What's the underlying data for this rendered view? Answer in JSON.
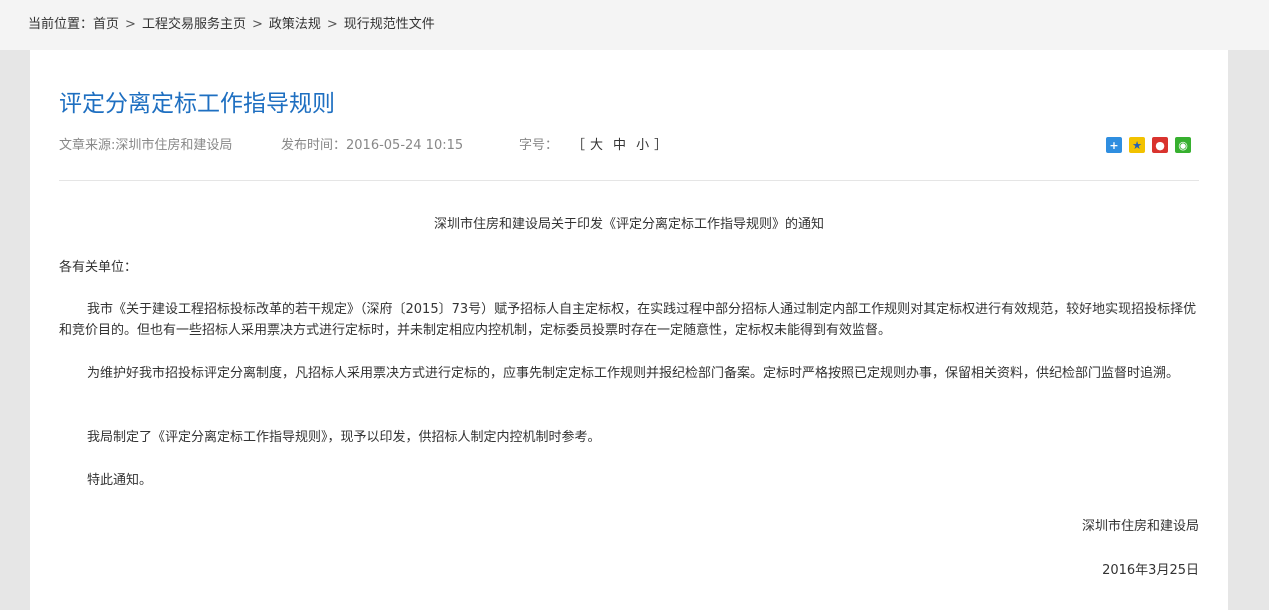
{
  "breadcrumb": {
    "prefix": "当前位置：",
    "items": [
      "首页",
      "工程交易服务主页",
      "政策法规",
      "现行规范性文件"
    ],
    "separator": ">"
  },
  "article": {
    "title": "评定分离定标工作指导规则",
    "source": "文章来源:深圳市住房和建设局",
    "publish_time": "发布时间：2016-05-24 10:15",
    "font_size_label": "字号：",
    "font_size_open": "［",
    "font_size_options": [
      "大",
      "中",
      "小"
    ],
    "font_size_close": "］",
    "share_icons": [
      "share-plus-icon",
      "qzone-icon",
      "weibo-icon",
      "wechat-icon"
    ],
    "notice_title": "深圳市住房和建设局关于印发《评定分离定标工作指导规则》的通知",
    "salutation": "各有关单位：",
    "paragraphs": [
      "我市《关于建设工程招标投标改革的若干规定》（深府〔2015〕73号）赋予招标人自主定标权，在实践过程中部分招标人通过制定内部工作规则对其定标权进行有效规范，较好地实现招投标择优和竞价目的。但也有一些招标人采用票决方式进行定标时，并未制定相应内控机制，定标委员投票时存在一定随意性，定标权未能得到有效监督。",
      "为维护好我市招投标评定分离制度，凡招标人采用票决方式进行定标的，应事先制定定标工作规则并报纪检部门备案。定标时严格按照已定规则办事，保留相关资料，供纪检部门监督时追溯。",
      "我局制定了《评定分离定标工作指导规则》，现予以印发，供招标人制定内控机制时参考。",
      "特此通知。"
    ],
    "signature": "深圳市住房和建设局",
    "date": "2016年3月25日"
  },
  "colors": {
    "title": "#1e6fc1",
    "background": "#e6e6e6",
    "topbar": "#f4f4f4",
    "page": "#ffffff"
  }
}
